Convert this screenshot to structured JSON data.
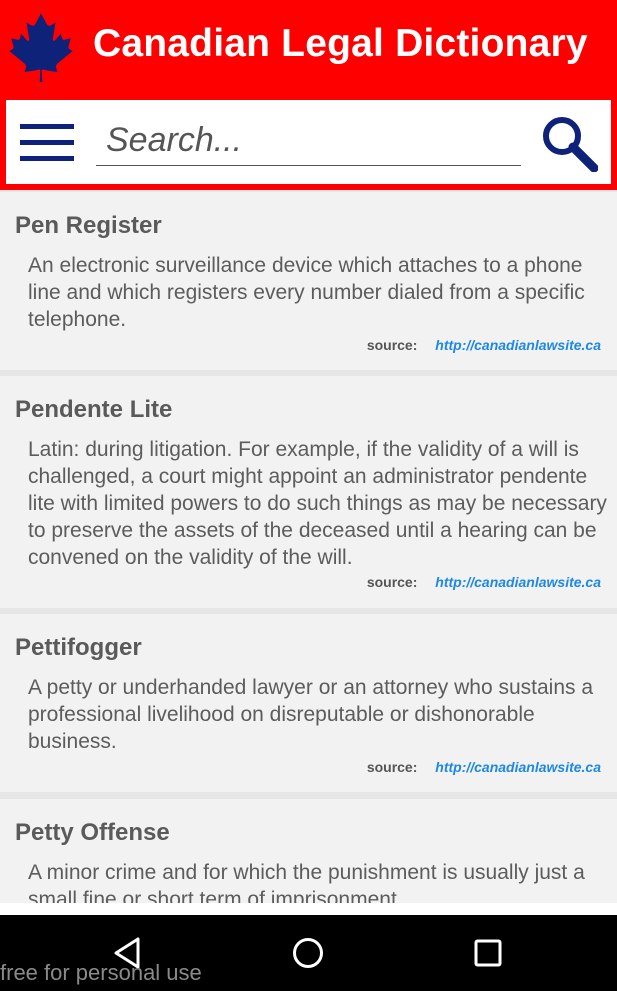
{
  "app": {
    "title": "Canadian Legal Dictionary",
    "brand_color": "#ff0000",
    "accent_color": "#0d2278",
    "icon": "maple-leaf-icon"
  },
  "search": {
    "placeholder": "Search...",
    "value": "",
    "menu_icon": "hamburger-menu-icon",
    "search_icon": "search-icon"
  },
  "entries": [
    {
      "term": "Pen Register",
      "definition": "An electronic surveillance device which attaches to a phone line and which registers every number dialed from a specific telephone.",
      "source_label": "source:",
      "source_url": "http://canadianlawsite.ca"
    },
    {
      "term": "Pendente Lite",
      "definition": "Latin: during litigation. For example, if the validity of a will is challenged, a court might appoint an administrator pendente lite with limited powers to do such things as may be necessary to preserve the assets of the deceased until a hearing can be convened on the validity of the will.",
      "source_label": "source:",
      "source_url": "http://canadianlawsite.ca"
    },
    {
      "term": "Pettifogger",
      "definition": "A petty or underhanded lawyer or an attorney who sustains a professional livelihood on disreputable or dishonorable business.",
      "source_label": "source:",
      "source_url": "http://canadianlawsite.ca"
    },
    {
      "term": "Petty Offense",
      "definition": "A minor crime and for which the punishment is usually just a small fine or short term of imprisonment."
    }
  ],
  "nav": {
    "back_icon": "back-triangle-icon",
    "home_icon": "home-circle-icon",
    "recents_icon": "recents-square-icon"
  },
  "watermark": "free for personal use"
}
